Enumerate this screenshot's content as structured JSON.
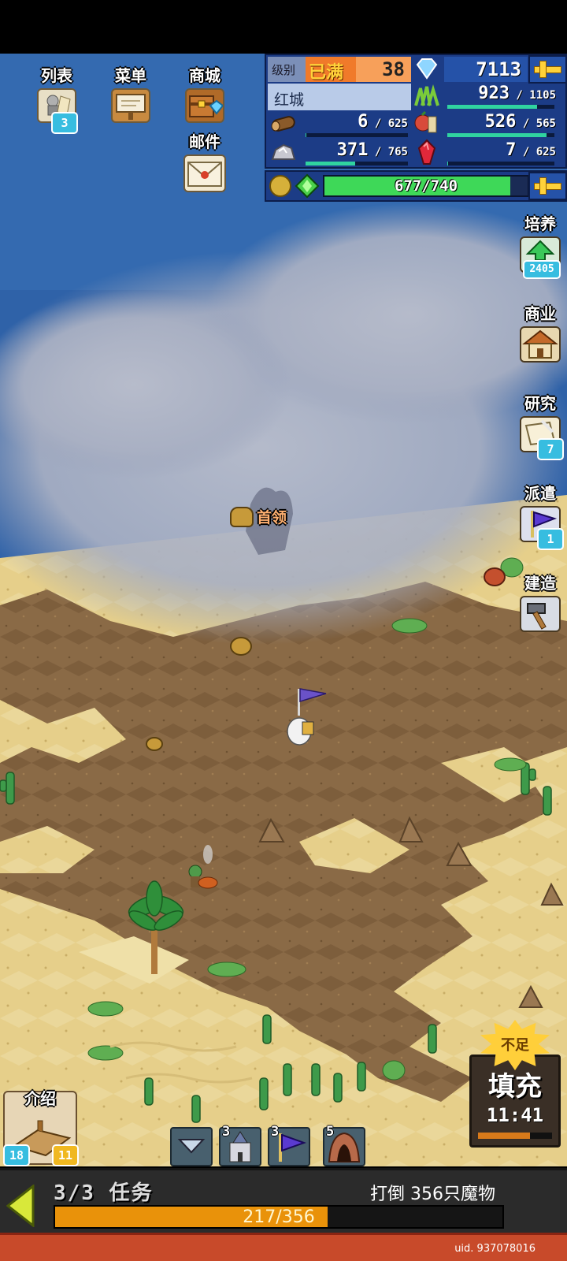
{
  "top_menu": [
    {
      "label": "列表",
      "badge": "3",
      "icon": "list-icon"
    },
    {
      "label": "菜单",
      "icon": "signboard-icon"
    },
    {
      "label": "商城",
      "icon": "shop-chest-icon"
    },
    {
      "label": "邮件",
      "icon": "mail-icon"
    }
  ],
  "resources": {
    "level_label": "级别",
    "level_status": "已满",
    "level": "38",
    "diamonds": "7113",
    "town_name": "红城",
    "grass": {
      "value": "923",
      "max": "1105",
      "fill": 0.835
    },
    "wood": {
      "value": "6",
      "max": "625",
      "fill": 0.01
    },
    "food": {
      "value": "526",
      "max": "565",
      "fill": 0.93
    },
    "ore": {
      "value": "371",
      "max": "765",
      "fill": 0.485
    },
    "ruby": {
      "value": "7",
      "max": "625",
      "fill": 0.011
    },
    "energy": {
      "value": "677",
      "max": "740",
      "fill": 0.915
    }
  },
  "side_menu": [
    {
      "label": "培养",
      "badge": "2405",
      "icon": "train-up-icon"
    },
    {
      "label": "商业",
      "icon": "house-icon"
    },
    {
      "label": "研究",
      "badge": "7",
      "icon": "research-scroll-icon"
    },
    {
      "label": "派遣",
      "badge": "1",
      "icon": "dispatch-flag-icon"
    },
    {
      "label": "建造",
      "icon": "hammer-icon"
    }
  ],
  "map": {
    "boss_label": "首领"
  },
  "refill": {
    "burst_text": "不足",
    "label": "填充",
    "timer": "11:41",
    "fill": 0.7
  },
  "intro": {
    "label": "介绍",
    "badge_left": "18",
    "badge_right": "11"
  },
  "toolbar": [
    {
      "count": "",
      "icon": "chevron-down-icon"
    },
    {
      "count": "3",
      "icon": "castle-icon"
    },
    {
      "count": "3",
      "icon": "flag-icon"
    },
    {
      "count": "5",
      "icon": "cave-icon"
    }
  ],
  "quest": {
    "title": "3/3 任务",
    "goal": "打倒 356只魔物",
    "progress_text": "217/356",
    "progress": 0.61
  },
  "uid": "uid. 937078016",
  "colors": {
    "sea": "#2f62a8",
    "sand": "#e6cf8a",
    "dirt": "#8a6a46",
    "panel": "#1c3c86",
    "accent_gold": "#ffd23a",
    "quest_fill": "#e9920a"
  }
}
